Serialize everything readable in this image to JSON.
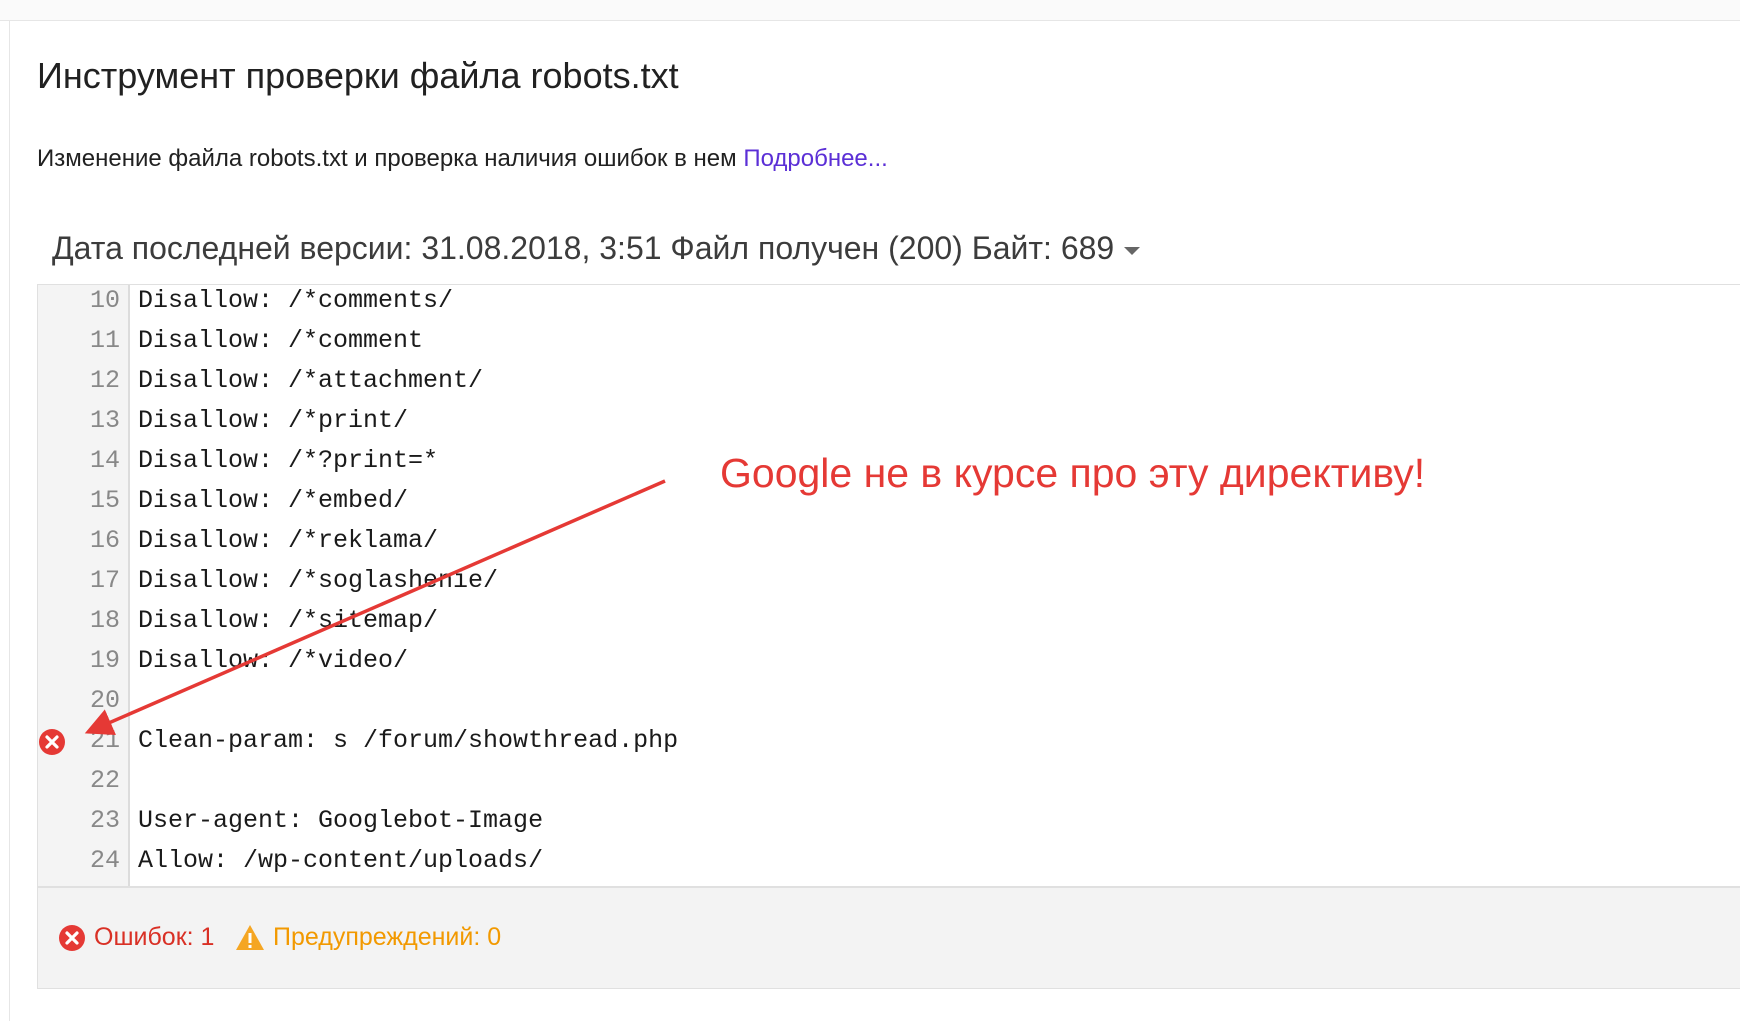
{
  "page": {
    "title": "Инструмент проверки файла robots.txt",
    "subtitle": "Изменение файла robots.txt и проверка наличия ошибок в нем",
    "learn_more": "Подробнее..."
  },
  "version_bar": {
    "text": "Дата последней версии: 31.08.2018, 3:51 Файл получен (200) Байт: 689"
  },
  "editor": {
    "lines": [
      {
        "num": "10",
        "text": "Disallow: /*comments/"
      },
      {
        "num": "11",
        "text": "Disallow: /*comment"
      },
      {
        "num": "12",
        "text": "Disallow: /*attachment/"
      },
      {
        "num": "13",
        "text": "Disallow: /*print/"
      },
      {
        "num": "14",
        "text": "Disallow: /*?print=*"
      },
      {
        "num": "15",
        "text": "Disallow: /*embed/"
      },
      {
        "num": "16",
        "text": "Disallow: /*reklama/"
      },
      {
        "num": "17",
        "text": "Disallow: /*soglashenie/"
      },
      {
        "num": "18",
        "text": "Disallow: /*sitemap/"
      },
      {
        "num": "19",
        "text": "Disallow: /*video/"
      },
      {
        "num": "20",
        "text": ""
      },
      {
        "num": "21",
        "text": "Clean-param: s /forum/showthread.php"
      },
      {
        "num": "22",
        "text": ""
      },
      {
        "num": "23",
        "text": "User-agent: Googlebot-Image"
      },
      {
        "num": "24",
        "text": "Allow: /wp-content/uploads/"
      }
    ]
  },
  "status": {
    "errors": "Ошибок: 1",
    "warnings": "Предупреждений: 0"
  },
  "annotation": {
    "text": "Google не в курсе про эту директиву!",
    "color": "#e53935"
  },
  "colors": {
    "error": "#d93025",
    "warning": "#f29900",
    "link": "#5b2fd6"
  }
}
